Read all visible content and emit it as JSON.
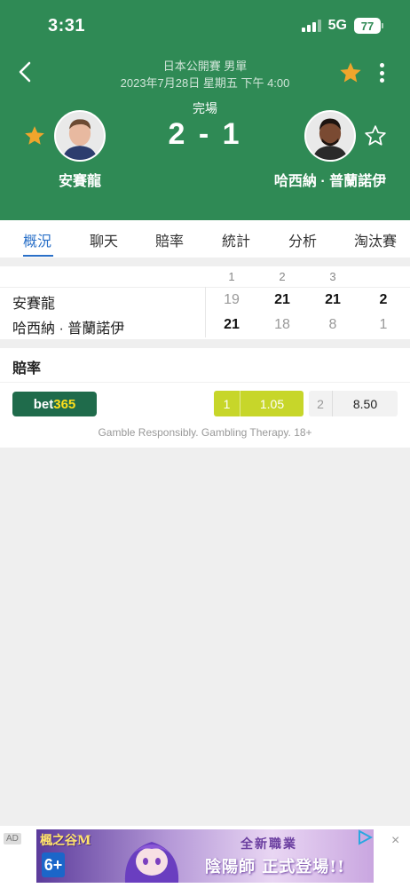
{
  "status_bar": {
    "time": "3:31",
    "network": "5G",
    "battery": "77"
  },
  "match": {
    "league": "日本公開賽 男單",
    "datetime": "2023年7月28日 星期五 下午 4:00",
    "status": "完場",
    "score": "2 - 1",
    "home": {
      "name": "安賽龍",
      "favorited": true
    },
    "away": {
      "name": "哈西納 · 普蘭諾伊",
      "favorited": false
    }
  },
  "tabs": [
    {
      "label": "概況",
      "active": true
    },
    {
      "label": "聊天"
    },
    {
      "label": "賠率"
    },
    {
      "label": "統計"
    },
    {
      "label": "分析"
    },
    {
      "label": "淘汰賽"
    }
  ],
  "sets": {
    "headers": [
      "1",
      "2",
      "3"
    ],
    "rows": [
      {
        "name": "安賽龍",
        "scores": [
          "19",
          "21",
          "21"
        ],
        "total": "2"
      },
      {
        "name": "哈西納 · 普蘭諾伊",
        "scores": [
          "21",
          "18",
          "8"
        ],
        "total": "1"
      }
    ]
  },
  "odds": {
    "title": "賠率",
    "bookmaker_white": "bet",
    "bookmaker_yellow": "365",
    "option1_label": "1",
    "option1_value": "1.05",
    "option2_label": "2",
    "option2_value": "8.50",
    "note": "Gamble Responsibly. Gambling Therapy. 18+"
  },
  "ad": {
    "tag": "AD",
    "game": "楓之谷M",
    "age": "6+",
    "line1": "全新職業",
    "line2": "陰陽師 正式登場!!",
    "close": "×"
  },
  "colors": {
    "header_bg": "#2f8a55",
    "accent_blue": "#2a70c8",
    "star": "#f0a52c",
    "odds_green": "#c7d62a"
  }
}
